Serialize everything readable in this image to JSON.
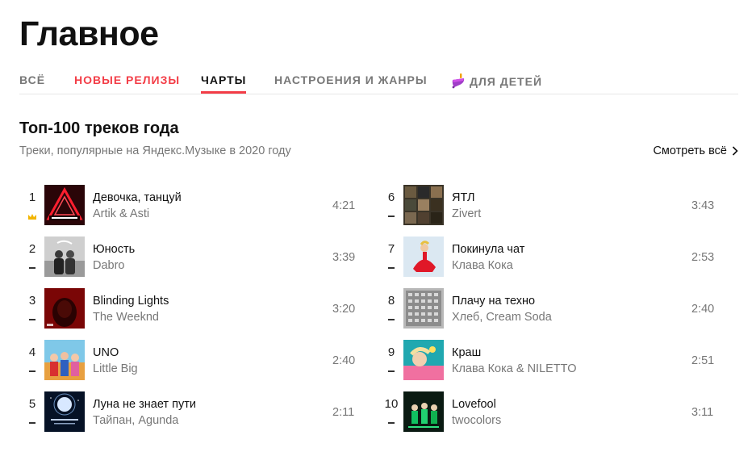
{
  "page": {
    "title": "Главное"
  },
  "tabs": [
    {
      "label": "ВСЁ"
    },
    {
      "label": "НОВЫЕ РЕЛИЗЫ"
    },
    {
      "label": "ЧАРТЫ"
    },
    {
      "label": "НАСТРОЕНИЯ И ЖАНРЫ"
    },
    {
      "label": "ДЛЯ ДЕТЕЙ",
      "icon": "spinning-top-icon"
    }
  ],
  "active_tab": "ЧАРТЫ",
  "colors": {
    "accent": "#f33d47",
    "crown": "#f2b500",
    "muted": "#777777"
  },
  "section": {
    "title": "Топ-100 треков года",
    "subtitle": "Треки, популярные на Яндекс.Музыке в 2020 году",
    "see_all": "Смотреть всё"
  },
  "tracks": [
    {
      "rank": "1",
      "title": "Девочка, танцуй",
      "artist": "Artik & Asti",
      "duration": "4:21",
      "change": "crown-icon"
    },
    {
      "rank": "2",
      "title": "Юность",
      "artist": "Dabro",
      "duration": "3:39",
      "change": "dash-icon"
    },
    {
      "rank": "3",
      "title": "Blinding Lights",
      "artist": "The Weeknd",
      "duration": "3:20",
      "change": "dash-icon"
    },
    {
      "rank": "4",
      "title": "UNO",
      "artist": "Little Big",
      "duration": "2:40",
      "change": "dash-icon"
    },
    {
      "rank": "5",
      "title": "Луна не знает пути",
      "artist": "Тайпан, Agunda",
      "duration": "2:11",
      "change": "dash-icon"
    },
    {
      "rank": "6",
      "title": "ЯТЛ",
      "artist": "Zivert",
      "duration": "3:43",
      "change": "dash-icon"
    },
    {
      "rank": "7",
      "title": "Покинула чат",
      "artist": "Клава Кока",
      "duration": "2:53",
      "change": "dash-icon"
    },
    {
      "rank": "8",
      "title": "Плачу на техно",
      "artist": "Хлеб, Cream Soda",
      "duration": "2:40",
      "change": "dash-icon"
    },
    {
      "rank": "9",
      "title": "Краш",
      "artist": "Клава Кока & NILETTO",
      "duration": "2:51",
      "change": "dash-icon"
    },
    {
      "rank": "10",
      "title": "Lovefool",
      "artist": "twocolors",
      "duration": "3:11",
      "change": "dash-icon"
    }
  ]
}
